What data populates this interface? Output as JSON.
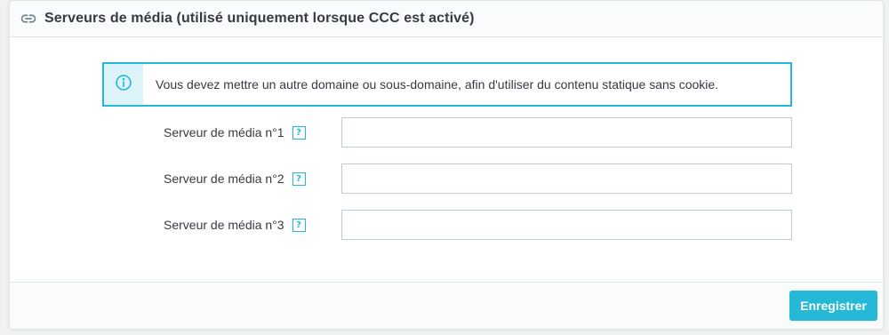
{
  "panel": {
    "title": "Serveurs de média (utilisé uniquement lorsque CCC est activé)",
    "heading_icon": "link-icon"
  },
  "alert": {
    "icon": "info-circle-icon",
    "message": "Vous devez mettre un autre domaine ou sous-domaine, afin d'utiliser du contenu statique sans cookie."
  },
  "fields": [
    {
      "label": "Serveur de média n°1",
      "help": "?",
      "value": ""
    },
    {
      "label": "Serveur de média n°2",
      "help": "?",
      "value": ""
    },
    {
      "label": "Serveur de média n°3",
      "help": "?",
      "value": ""
    }
  ],
  "footer": {
    "save_label": "Enregistrer"
  },
  "colors": {
    "accent": "#25b9d7",
    "alert_icon_bg": "#dcf4f9",
    "text": "#363a41",
    "border": "#bbcdd2"
  }
}
